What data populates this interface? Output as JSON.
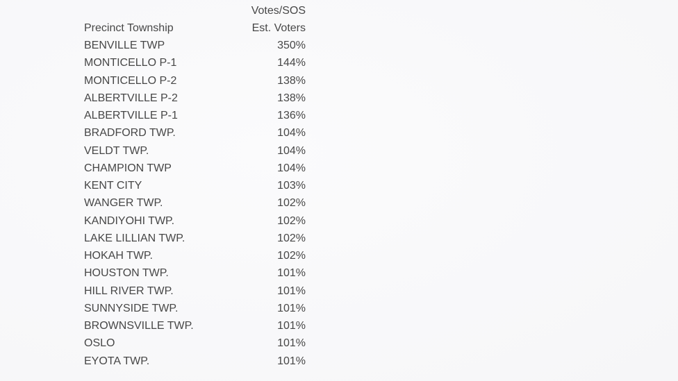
{
  "document": {
    "header": {
      "col1": "Precinct Township",
      "col2_line1": "Votes/SOS",
      "col2_line2": "Est. Voters"
    },
    "rows": [
      {
        "precinct": "BENVILLE TWP",
        "pct": "350%"
      },
      {
        "precinct": "MONTICELLO P-1",
        "pct": "144%"
      },
      {
        "precinct": "MONTICELLO P-2",
        "pct": "138%"
      },
      {
        "precinct": "ALBERTVILLE P-2",
        "pct": "138%"
      },
      {
        "precinct": "ALBERTVILLE P-1",
        "pct": "136%"
      },
      {
        "precinct": "BRADFORD TWP.",
        "pct": "104%"
      },
      {
        "precinct": "VELDT TWP.",
        "pct": "104%"
      },
      {
        "precinct": "CHAMPION TWP",
        "pct": "104%"
      },
      {
        "precinct": "KENT CITY",
        "pct": "103%"
      },
      {
        "precinct": "WANGER TWP.",
        "pct": "102%"
      },
      {
        "precinct": "KANDIYOHI TWP.",
        "pct": "102%"
      },
      {
        "precinct": "LAKE LILLIAN TWP.",
        "pct": "102%"
      },
      {
        "precinct": "HOKAH TWP.",
        "pct": "102%"
      },
      {
        "precinct": "HOUSTON TWP.",
        "pct": "101%"
      },
      {
        "precinct": "HILL RIVER TWP.",
        "pct": "101%"
      },
      {
        "precinct": "SUNNYSIDE TWP.",
        "pct": "101%"
      },
      {
        "precinct": "BROWNSVILLE TWP.",
        "pct": "101%"
      },
      {
        "precinct": "OSLO",
        "pct": "101%"
      },
      {
        "precinct": "EYOTA TWP.",
        "pct": "101%"
      }
    ]
  }
}
